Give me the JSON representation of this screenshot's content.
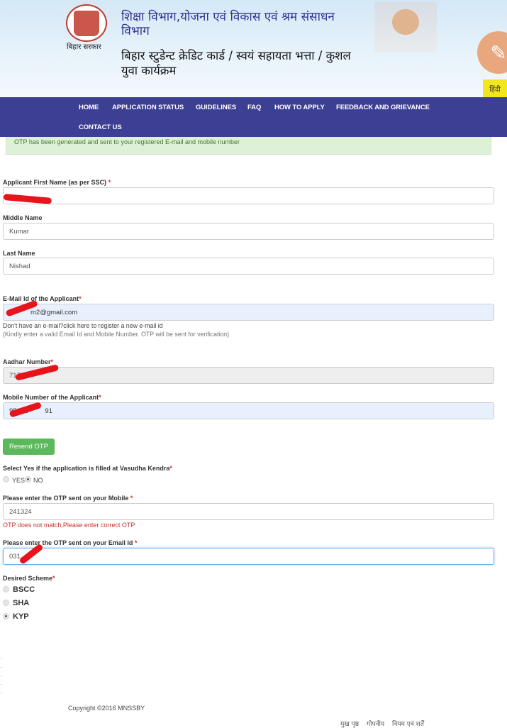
{
  "header": {
    "logo_caption": "बिहार सरकार",
    "department": "शिक्षा विभाग,योजना एवं विकास एवं श्रम संसाधन विभाग",
    "scheme_title": "बिहार स्टुडेन्ट क्रेडिट कार्ड / स्वयं सहायता भत्ता / कुशल युवा कार्यक्रम",
    "language_toggle": "हिंदी",
    "paint_icon": "paint-brush-icon"
  },
  "nav": {
    "items": [
      "HOME",
      "APPLICATION STATUS",
      "GUIDELINES",
      "FAQ",
      "HOW TO APPLY",
      "FEEDBACK AND GRIEVANCE",
      "CONTACT US"
    ]
  },
  "alert": "OTP has been generated and sent to your registered E-mail and mobile number",
  "form": {
    "first_name": {
      "label": "Applicant First Name (as per SSC)",
      "required": "*",
      "value": ""
    },
    "middle_name": {
      "label": "Middle Name",
      "value": "Kumar"
    },
    "last_name": {
      "label": "Last Name",
      "value": "Nishad"
    },
    "email": {
      "label": "E-Mail Id of the Applicant",
      "required": "*",
      "value": "m2@gmail.com"
    },
    "email_help": "Don't have an e-mail?click here to register a new e-mail id",
    "email_note": "(Kindly enter a valid Email Id and Mobile Number. OTP will be sent for verification)",
    "aadhar": {
      "label": "Aadhar Number",
      "required": "*",
      "value": "717"
    },
    "mobile": {
      "label": "Mobile Number of the Applicant",
      "required": "*",
      "value": "95102",
      "value_end": "91"
    },
    "resend_otp": "Resend OTP",
    "vasudha": {
      "label": "Select Yes if the application is filled at Vasudha Kendra",
      "required": "*",
      "options": [
        "YES",
        "NO"
      ],
      "selected": "NO"
    },
    "mobile_otp": {
      "label": "Please enter the OTP sent on your Mobile ",
      "required": "*",
      "value": "241324",
      "error": "OTP does not match,Please enter correct OTP"
    },
    "email_otp": {
      "label": "Please enter the OTP sent on your Email Id ",
      "required": "*",
      "value": "031"
    },
    "scheme": {
      "label": "Desired Scheme",
      "required": "*",
      "options": [
        "BSCC",
        "SHA",
        "KYP"
      ],
      "selected": "KYP"
    }
  },
  "footer": {
    "copyright": "Copyright ©2016 MNSSBY",
    "links": [
      "मुख पृष्ठ",
      "गोपनीय",
      "नियम एवं शर्तें"
    ]
  },
  "colors": {
    "nav": "#3c3f94",
    "button": "#5cb85c",
    "error": "#c9302c",
    "alert_bg": "#dff0d8",
    "redaction": "#e8141b"
  }
}
